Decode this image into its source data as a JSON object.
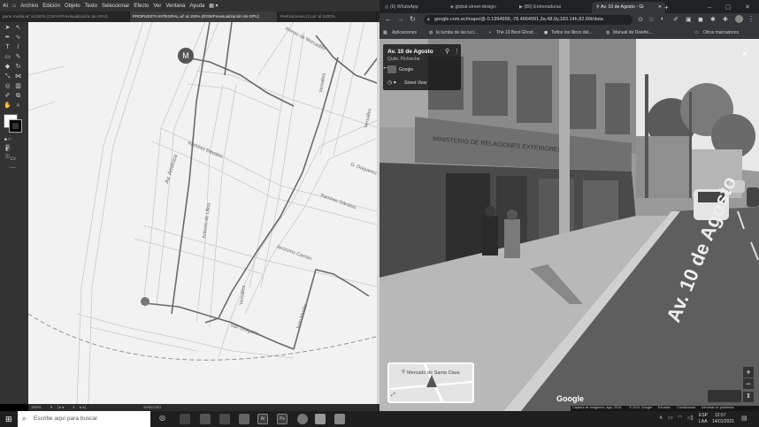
{
  "illustrator": {
    "logo": "Ai",
    "menu": [
      "Archivo",
      "Edición",
      "Objeto",
      "Texto",
      "Seleccionar",
      "Efecto",
      "Ver",
      "Ventana",
      "Ayuda"
    ],
    "tabs": [
      {
        "label": "parte media.ai* al 240% (CMYK/Previsualización de GPU)",
        "active": false
      },
      {
        "label": "PROPUESTA INTEGRAL.ai* al 150% (RGB/Previsualización de GPU)",
        "active": true
      },
      {
        "label": "Perfoniciones (1).ai* al 1200%",
        "active": false
      }
    ],
    "canvas_labels": {
      "metro": "M",
      "av_america": "Av. América",
      "ramirez_davalos_1": "Ramírez Dávalos",
      "ramirez_davalos_2": "Ramírez Dávalos",
      "antonio_ulloa": "Antonio de Ulloa",
      "versalles_1": "Versalles",
      "versalles_2": "Versalles",
      "versalles_3": "Versalles",
      "jeronimo_carrion": "Jerónimo Carrión",
      "san_gregorio": "San Gregorio",
      "juan_murillo": "Juan Murillo",
      "g_daquerez": "G. Daquerez",
      "alonso_mercadillo": "Alonso de Mercadillo"
    },
    "status": {
      "zoom": "150%",
      "page": "4",
      "mode": "Selección"
    }
  },
  "chrome": {
    "tabs": [
      {
        "label": "(6) WhatsApp",
        "active": false
      },
      {
        "label": "global-street-design-",
        "active": false
      },
      {
        "label": "(80) Entrenaduras",
        "active": false
      },
      {
        "label": "Av. 10 de Agosto - Gi",
        "active": true
      }
    ],
    "new_tab": "+",
    "url": "google.com.ec/maps/@-0.1994958,-78.4964991,3a,48.9y,183.14h,82.66t/data",
    "bookmarks": [
      "Aplicaciones",
      "la tumba de las luci...",
      "The 10 Best Ghost...",
      "Todos los libros del...",
      "Manual de Diseño..."
    ],
    "other_bookmarks": "Otros marcadores"
  },
  "street_view": {
    "title": "Av. 10 de Agosto",
    "subtitle": "Quito, Pichincha",
    "provider": "Google",
    "mode": "Street View",
    "road_label": "Av. 10 de Agosto",
    "minimap_label": "Mercado de Santa Clara",
    "google_logo": "Google",
    "footer": [
      "Captura de imágenes: ago. 2015",
      "© 2021 Google",
      "Ecuador",
      "Condiciones",
      "Informar un problema"
    ]
  },
  "taskbar": {
    "search_placeholder": "Escribe aquí para buscar",
    "lang": "ESP",
    "lang_sub": "LAA",
    "time": "12:57",
    "date": "14/01/2021"
  }
}
